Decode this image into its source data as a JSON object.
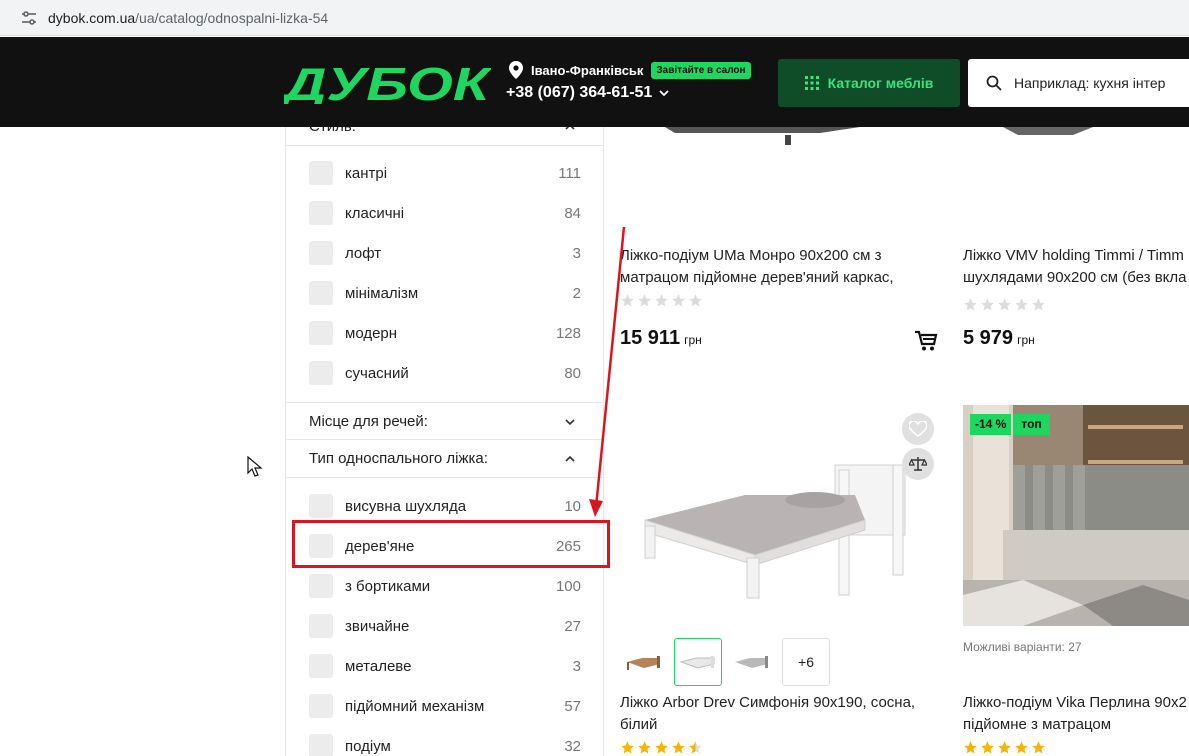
{
  "browser": {
    "url_domain": "dybok.com.ua",
    "url_path": "/ua/catalog/odnospalni-lizka-54"
  },
  "header": {
    "logo_text": "ДУБОК",
    "city": "Івано-Франківськ",
    "salon_badge": "Завітайте в салон",
    "phone": "+38 (067) 364-61-51",
    "catalog_button": "Каталог меблів",
    "search_placeholder": "Наприклад: кухня інтер",
    "brand_color": "#1ed760"
  },
  "sidebar": {
    "style_heading": "Стиль:",
    "style_options": [
      {
        "label": "кантрі",
        "count": "111"
      },
      {
        "label": "класичні",
        "count": "84"
      },
      {
        "label": "лофт",
        "count": "3"
      },
      {
        "label": "мінімалізм",
        "count": "2"
      },
      {
        "label": "модерн",
        "count": "128"
      },
      {
        "label": "сучасний",
        "count": "80"
      }
    ],
    "storage_heading": "Місце для речей:",
    "bed_type_heading": "Тип односпального ліжка:",
    "bed_type_options": [
      {
        "label": "висувна шухляда",
        "count": "10"
      },
      {
        "label": "дерев'яне",
        "count": "265"
      },
      {
        "label": "з бортиками",
        "count": "100"
      },
      {
        "label": "звичайне",
        "count": "27"
      },
      {
        "label": "металеве",
        "count": "3"
      },
      {
        "label": "підйомний механізм",
        "count": "57"
      },
      {
        "label": "подіум",
        "count": "32"
      }
    ]
  },
  "products": [
    {
      "title_line1": "Ліжко-подіум UMa Монро 90x200 см з",
      "title_line2": "матрацом підйомне дерев'яний каркас,",
      "price": "15 911",
      "currency": "грн",
      "rating": 0
    },
    {
      "title_line1": "Ліжко VMV holding Timmi / Timm",
      "title_line2": "шухлядами 90x200 см (без вкла",
      "price": "5 979",
      "currency": "грн",
      "rating": 0
    },
    {
      "title_line1": "Ліжко Arbor Drev Симфонія 90x190, сосна,",
      "title_line2": "білий",
      "variants_more": "+6",
      "rating": 4.5
    },
    {
      "discount_badge": "-14 %",
      "top_badge": "топ",
      "variants_text": "Можливі варіанти: 27",
      "title_line1": "Ліжко-подіум Vika Перлина 90x2",
      "title_line2": "підйомне з матрацом",
      "rating": 5
    }
  ]
}
